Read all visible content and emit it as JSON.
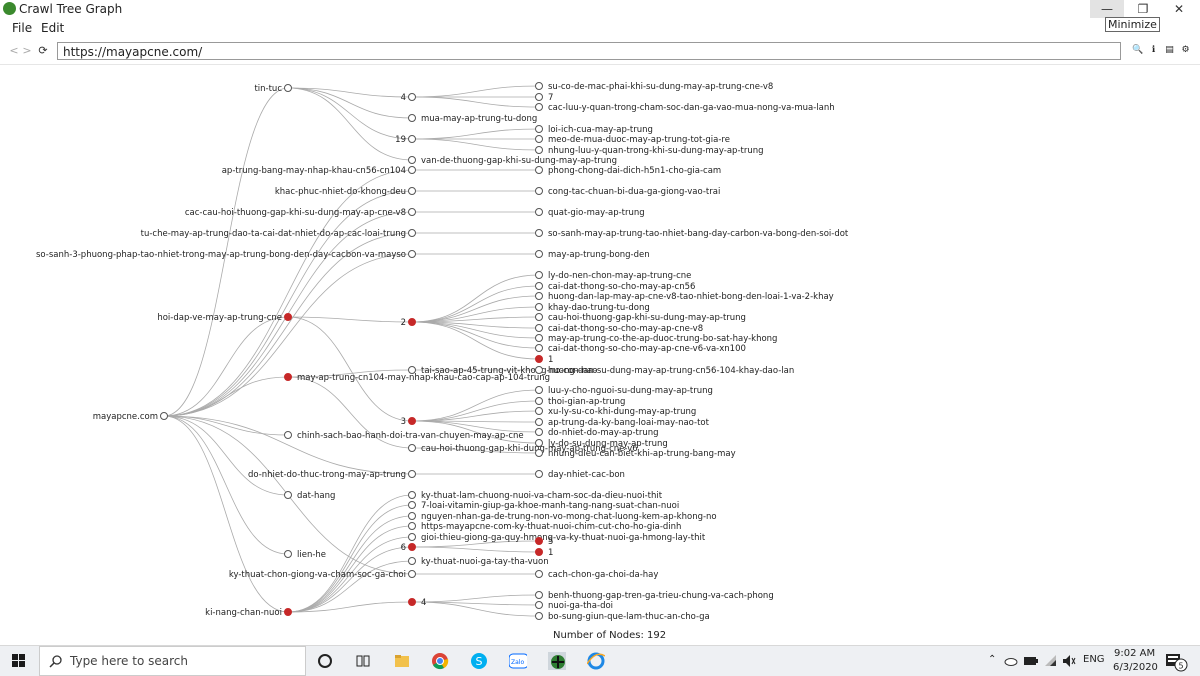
{
  "window": {
    "title": "Crawl Tree Graph",
    "minimize_tooltip": "Minimize",
    "min_glyph": "—",
    "max_glyph": "❐",
    "close_glyph": "✕"
  },
  "menu": {
    "items": [
      "File",
      "Edit"
    ]
  },
  "toolbar": {
    "back_glyph": "<",
    "forward_glyph": ">",
    "reload_glyph": "⟳",
    "url": "https://mayapcne.com/",
    "tool_glyphs": [
      "🔍",
      "ℹ",
      "▤",
      "⚙"
    ]
  },
  "graph": {
    "root": "mayapcne.com",
    "nodes": [
      "tin-tuc",
      "4",
      "mua-may-ap-trung-tu-dong",
      "19",
      "van-de-thuong-gap-khi-su-dung-may-ap-trung",
      "su-co-de-mac-phai-khi-su-dung-may-ap-trung-cne-v8",
      "7",
      "cac-luu-y-quan-trong-cham-soc-dan-ga-vao-mua-nong-va-mua-lanh",
      "loi-ich-cua-may-ap-trung",
      "meo-de-mua-duoc-may-ap-trung-tot-gia-re",
      "nhung-luu-y-quan-trong-khi-su-dung-may-ap-trung",
      "ap-trung-bang-may-nhap-khau-cn56-cn104",
      "phong-chong-dai-dich-h5n1-cho-gia-cam",
      "khac-phuc-nhiet-do-khong-deu",
      "cong-tac-chuan-bi-dua-ga-giong-vao-trai",
      "cac-cau-hoi-thuong-gap-khi-su-dung-may-ap-cne-v8",
      "quat-gio-may-ap-trung",
      "tu-che-may-ap-trung-dao-ta-cai-dat-nhiet-do-ap-cac-loai-trung",
      "so-sanh-may-ap-trung-tao-nhiet-bang-day-carbon-va-bong-den-soi-dot",
      "so-sanh-3-phuong-phap-tao-nhiet-trong-may-ap-trung-bong-den-day-cacbon-va-mayso",
      "may-ap-trung-bong-den",
      "hoi-dap-ve-may-ap-trung-cne",
      "2",
      "ly-do-nen-chon-may-ap-trung-cne",
      "cai-dat-thong-so-cho-may-ap-cn56",
      "huong-dan-lap-may-ap-cne-v8-tao-nhiet-bong-den-loai-1-va-2-khay",
      "khay-dao-trung-tu-dong",
      "cau-hoi-thuong-gap-khi-su-dung-may-ap-trung",
      "cai-dat-thong-so-cho-may-ap-cne-v8",
      "may-ap-trung-co-the-ap-duoc-trung-bo-sat-hay-khong",
      "cai-dat-thong-so-cho-may-ap-cne-v6-va-xn100",
      "1",
      "may-ap-trung-cn104-may-nhap-khau-cao-cap-ap-104-trung",
      "tai-sao-ap-45-trung-vit-khong-no-con-nao",
      "huong-dan-su-dung-may-ap-trung-cn56-104-khay-dao-lan",
      "3",
      "luu-y-cho-nguoi-su-dung-may-ap-trung",
      "thoi-gian-ap-trung",
      "xu-ly-su-co-khi-dung-may-ap-trung",
      "ap-trung-da-ky-bang-loai-may-nao-tot",
      "do-nhiet-do-may-ap-trung",
      "ly-do-su-dung-may-ap-trung",
      "chinh-sach-bao-hanh-doi-tra-van-chuyen-may-ap-cne",
      "cau-hoi-thuong-gap-khi-dung-may-ap-trung-cne-v6",
      "nhung-dieu-can-biet-khi-ap-trung-bang-may",
      "do-nhiet-do-thuc-trong-may-ap-trung",
      "day-nhiet-cac-bon",
      "dat-hang",
      "ky-thuat-lam-chuong-nuoi-va-cham-soc-da-dieu-nuoi-thit",
      "7-loai-vitamin-giup-ga-khoe-manh-tang-nang-suat-chan-nuoi",
      "nguyen-nhan-ga-de-trung-non-vo-mong-chat-luong-kem-ap-khong-no",
      "https-mayapcne-com-ky-thuat-nuoi-chim-cut-cho-ho-gia-dinh",
      "gioi-thieu-giong-ga-quy-hmong-va-ky-thuat-nuoi-ga-hmong-lay-thit",
      "5",
      "lien-he",
      "6",
      "1",
      "ky-thuat-nuoi-ga-tay-tha-vuon",
      "ky-thuat-chon-giong-va-cham-soc-ga-choi",
      "cach-chon-ga-choi-da-hay",
      "4",
      "benh-thuong-gap-tren-ga-trieu-chung-va-cach-phong",
      "nuoi-ga-tha-doi",
      "bo-sung-giun-que-lam-thuc-an-cho-ga",
      "ki-nang-chan-nuoi"
    ],
    "node_count_label": "Number of Nodes: 192"
  },
  "taskbar": {
    "search_placeholder": "Type here to search",
    "apps": [
      "task-view",
      "file-explorer",
      "chrome",
      "skype",
      "zalo",
      "crawl-app",
      "ie"
    ],
    "tray_lang": "ENG",
    "time": "9:02 AM",
    "date": "6/3/2020",
    "notifications": "5"
  },
  "colors": {
    "expanded": "#c62828",
    "collapsed_fill": "#ffffff",
    "edge": "#aaaaaa"
  }
}
